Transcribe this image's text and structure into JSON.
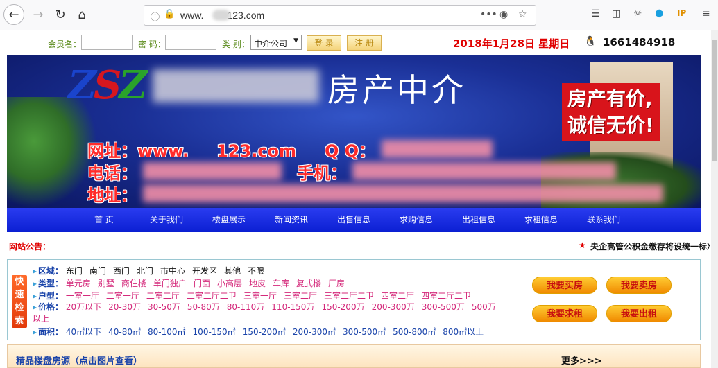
{
  "browser": {
    "url_prefix": "www.",
    "url_suffix": "123.com",
    "more_glyph": "•••"
  },
  "login": {
    "member_label": "会员名：",
    "password_label": "密 码：",
    "category_label": "类 别：",
    "category_selected": "中介公司",
    "login_button": "登 录",
    "register_button": "注 册",
    "date_text": "2018年1月28日 星期日",
    "qq_number": "1661484918"
  },
  "banner": {
    "title": "房产中介",
    "slogan_line1": "房产有价,",
    "slogan_line2": "诚信无价!",
    "website_label": "网址：www.",
    "website_suffix": "123.com",
    "qq_label": "Q Q：",
    "phone_label": "电话：",
    "mobile_label": "手机：",
    "address_label": "地址："
  },
  "nav": {
    "items": [
      "首 页",
      "关于我们",
      "楼盘展示",
      "新闻资讯",
      "出售信息",
      "求购信息",
      "出租信息",
      "求租信息",
      "联系我们"
    ]
  },
  "notice": {
    "label": "网站公告：",
    "text": "央企高管公积金缴存将设统一标准"
  },
  "quick_search": {
    "tag": "快速检索",
    "area": {
      "label": "区域：",
      "options": [
        "东门",
        "南门",
        "西门",
        "北门",
        "市中心",
        "开发区",
        "其他",
        "不限"
      ]
    },
    "type": {
      "label": "类型：",
      "options": [
        "单元房",
        "别墅",
        "商住楼",
        "单门独户",
        "门面",
        "小高层",
        "地皮",
        "车库",
        "复式楼",
        "厂房"
      ]
    },
    "layout": {
      "label": "户型：",
      "options": [
        "一室一厅",
        "二室一厅",
        "二室二厅",
        "二室二厅二卫",
        "三室一厅",
        "三室二厅",
        "三室二厅二卫",
        "四室二厅",
        "四室二厅二卫"
      ]
    },
    "price": {
      "label": "价格：",
      "options": [
        "20万以下",
        "20-30万",
        "30-50万",
        "50-80万",
        "80-110万",
        "110-150万",
        "150-200万",
        "200-300万",
        "300-500万",
        "500万以上"
      ]
    },
    "size": {
      "label": "面积：",
      "options": [
        "40㎡以下",
        "40-80㎡",
        "80-100㎡",
        "100-150㎡",
        "150-200㎡",
        "200-300㎡",
        "300-500㎡",
        "500-800㎡",
        "800㎡以上"
      ]
    },
    "buttons": {
      "buy": "我要买房",
      "sell": "我要卖房",
      "rent_seek": "我要求租",
      "rent_out": "我要出租"
    }
  },
  "featured": {
    "title": "精品楼盘房源（点击图片查看）",
    "more": "更多>>>"
  },
  "colors": {
    "nav": "#1a2ce0",
    "date": "#e00000",
    "accent": "#f08a00"
  }
}
